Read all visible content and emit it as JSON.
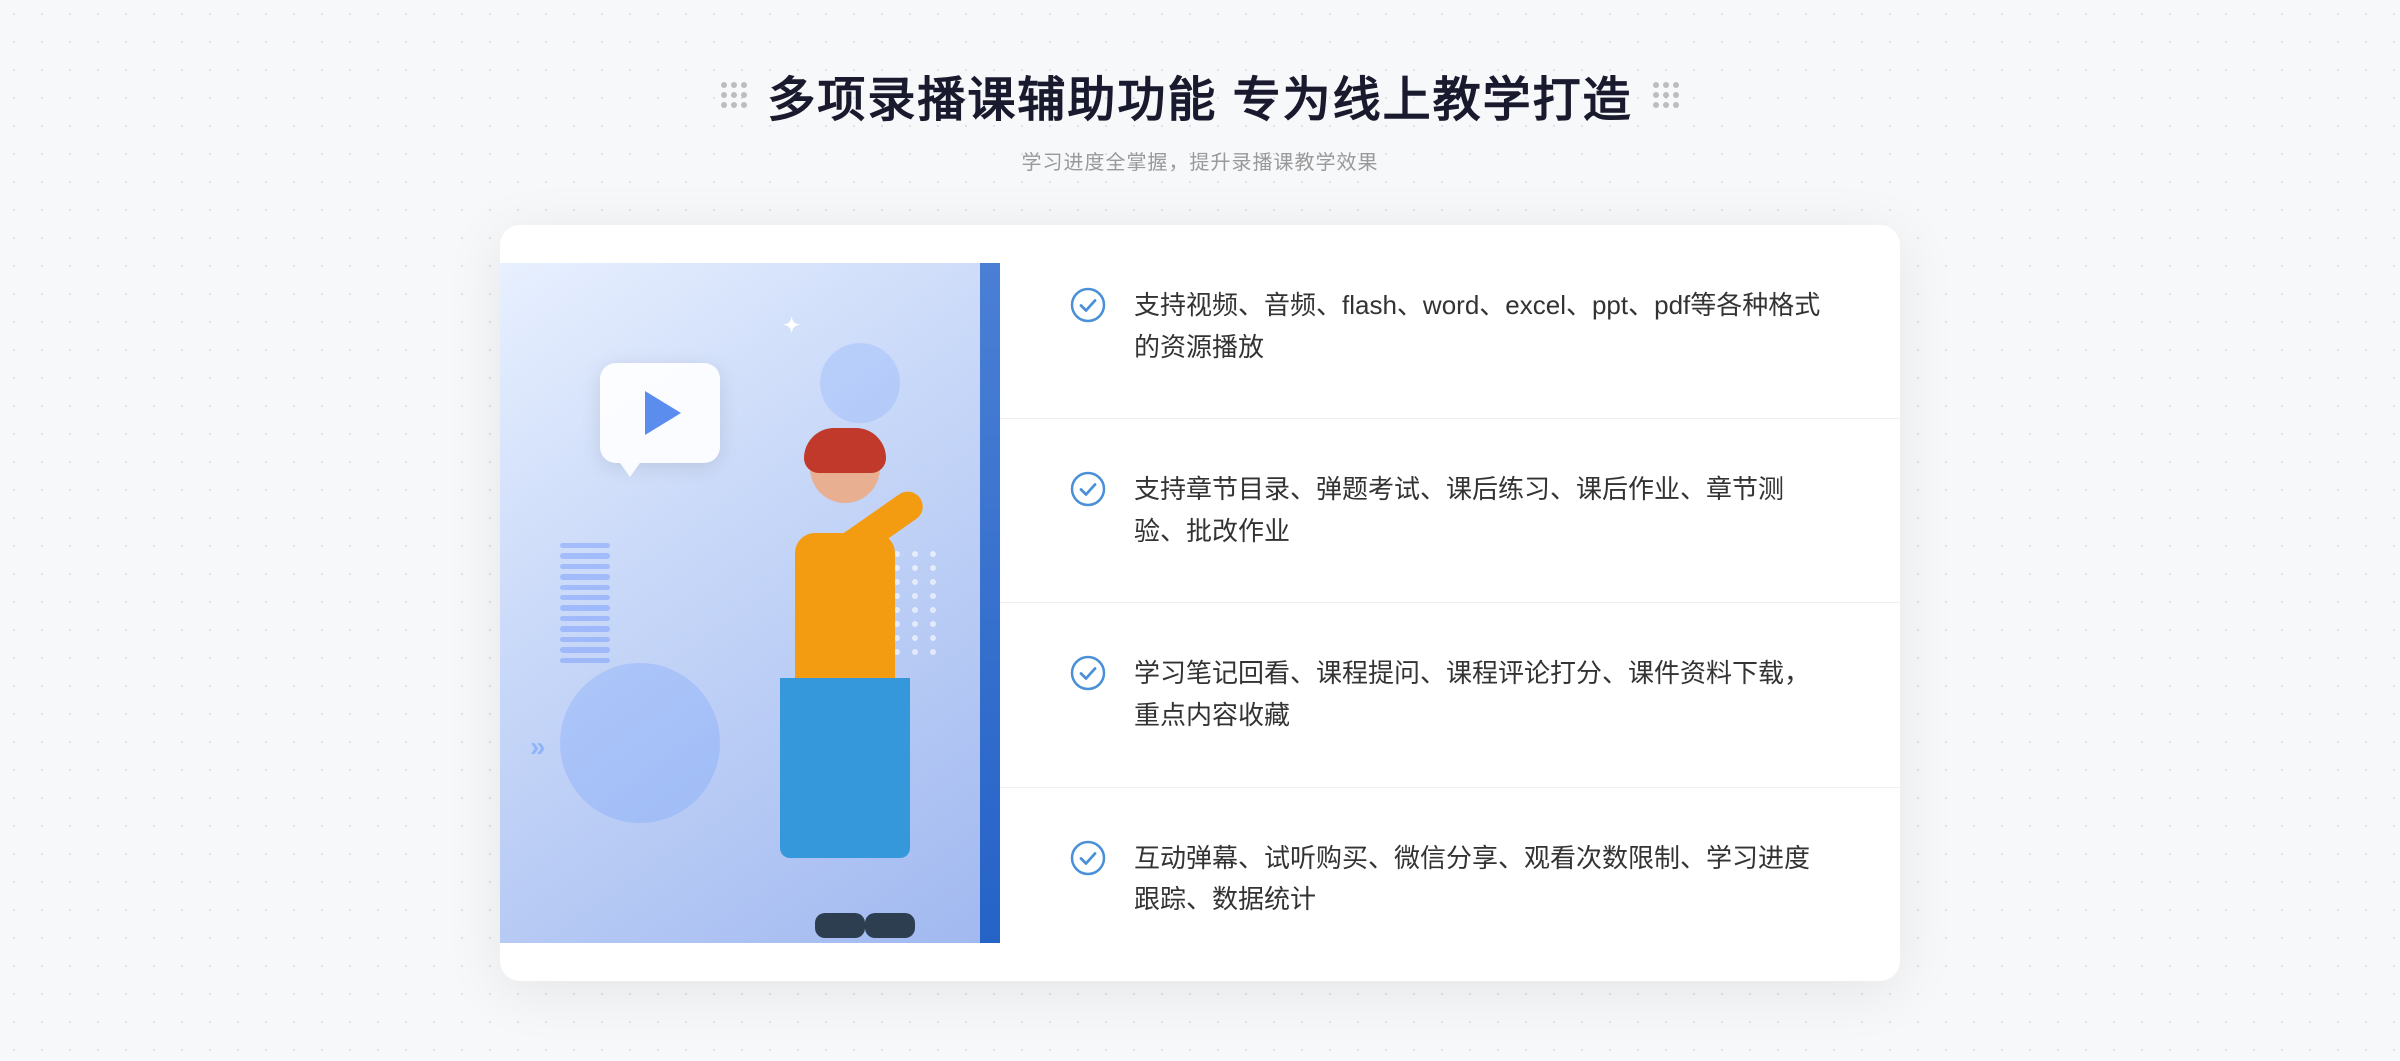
{
  "header": {
    "title": "多项录播课辅助功能 专为线上教学打造",
    "subtitle": "学习进度全掌握，提升录播课教学效果"
  },
  "features": [
    {
      "id": "feature-1",
      "text": "支持视频、音频、flash、word、excel、ppt、pdf等各种格式的资源播放"
    },
    {
      "id": "feature-2",
      "text": "支持章节目录、弹题考试、课后练习、课后作业、章节测验、批改作业"
    },
    {
      "id": "feature-3",
      "text": "学习笔记回看、课程提问、课程评论打分、课件资料下载，重点内容收藏"
    },
    {
      "id": "feature-4",
      "text": "互动弹幕、试听购买、微信分享、观看次数限制、学习进度跟踪、数据统计"
    }
  ]
}
